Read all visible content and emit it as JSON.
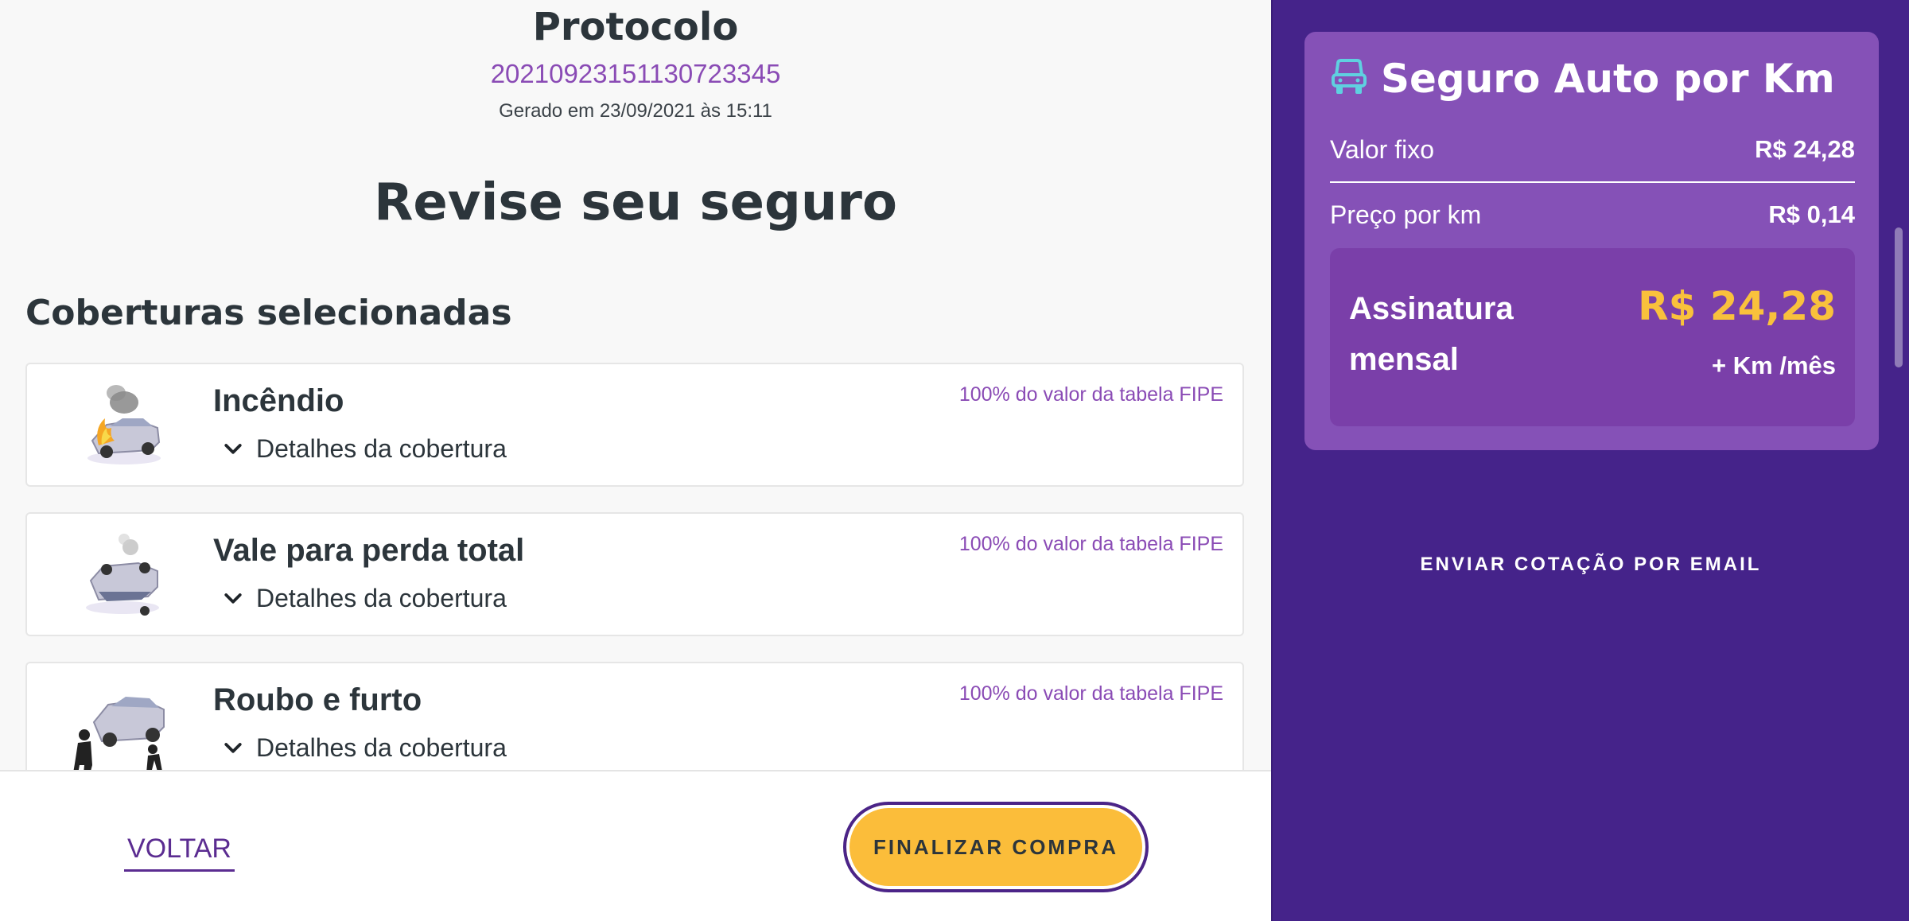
{
  "header": {
    "protocol_title": "Protocolo",
    "protocol_number": "20210923151130723345",
    "generated_at": "Gerado em 23/09/2021 às 15:11"
  },
  "page_title": "Revise seu seguro",
  "coverages": {
    "section_title": "Coberturas selecionadas",
    "items": [
      {
        "name": "Incêndio",
        "details_label": "Detalhes da cobertura",
        "fipe": "100% do valor da tabela FIPE",
        "icon": "car-fire-illustration"
      },
      {
        "name": "Vale para perda total",
        "details_label": "Detalhes da cobertura",
        "fipe": "100% do valor da tabela FIPE",
        "icon": "car-overturned-illustration"
      },
      {
        "name": "Roubo e furto",
        "details_label": "Detalhes da cobertura",
        "fipe": "100% do valor da tabela FIPE",
        "icon": "car-theft-illustration"
      }
    ]
  },
  "footer": {
    "back_label": "VOLTAR",
    "finish_label": "FINALIZAR COMPRA"
  },
  "summary": {
    "title": "Seguro Auto por Km",
    "icon": "car-front-icon",
    "fixed_label": "Valor fixo",
    "fixed_value": "R$ 24,28",
    "km_label": "Preço por km",
    "km_value": "R$ 0,14",
    "subscription_label": "Assinatura mensal",
    "subscription_value": "R$ 24,28",
    "subscription_unit": "+ Km /mês"
  },
  "email_link": "ENVIAR COTAÇÃO POR EMAIL",
  "colors": {
    "accent_purple": "#45238a",
    "card_purple": "#8551b7",
    "highlight_yellow": "#f9c13c",
    "button_yellow": "#fbbd3a",
    "text_dark": "#2c353b",
    "link_purple": "#8a4bb5"
  }
}
